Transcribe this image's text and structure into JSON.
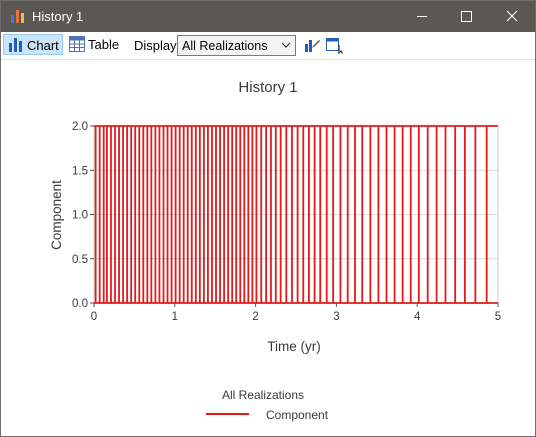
{
  "window": {
    "title": "History 1"
  },
  "toolbar": {
    "chart_label": "Chart",
    "table_label": "Table",
    "display_label": "Display:",
    "display_value": "All Realizations"
  },
  "chart_data": {
    "type": "line",
    "title": "History 1",
    "xlabel": "Time (yr)",
    "ylabel": "Component",
    "xlim": [
      0,
      5
    ],
    "ylim": [
      0,
      2
    ],
    "x_ticks": [
      "0",
      "1",
      "2",
      "3",
      "4",
      "5"
    ],
    "y_ticks": [
      "0.0",
      "0.5",
      "1.0",
      "1.5",
      "2.0"
    ],
    "grid": true,
    "legend_title": "All Realizations",
    "legend_placement": "bottom-center",
    "series": [
      {
        "name": "Component",
        "color": "#e31a1c",
        "step_times": [
          0.02,
          0.07,
          0.12,
          0.16,
          0.21,
          0.26,
          0.31,
          0.36,
          0.41,
          0.46,
          0.51,
          0.56,
          0.61,
          0.66,
          0.71,
          0.76,
          0.81,
          0.86,
          0.91,
          0.96,
          1.01,
          1.06,
          1.11,
          1.16,
          1.21,
          1.26,
          1.31,
          1.36,
          1.41,
          1.46,
          1.51,
          1.56,
          1.61,
          1.66,
          1.71,
          1.76,
          1.81,
          1.86,
          1.91,
          1.96,
          2.01,
          2.07,
          2.13,
          2.19,
          2.25,
          2.31,
          2.38,
          2.45,
          2.52,
          2.59,
          2.66,
          2.73,
          2.8,
          2.88,
          2.96,
          3.05,
          3.14,
          3.23,
          3.32,
          3.42,
          3.52,
          3.62,
          3.72,
          3.82,
          3.92,
          4.02,
          4.13,
          4.24,
          4.35,
          4.47,
          4.59,
          4.72,
          4.86
        ],
        "min": 0,
        "max": 2
      }
    ]
  }
}
